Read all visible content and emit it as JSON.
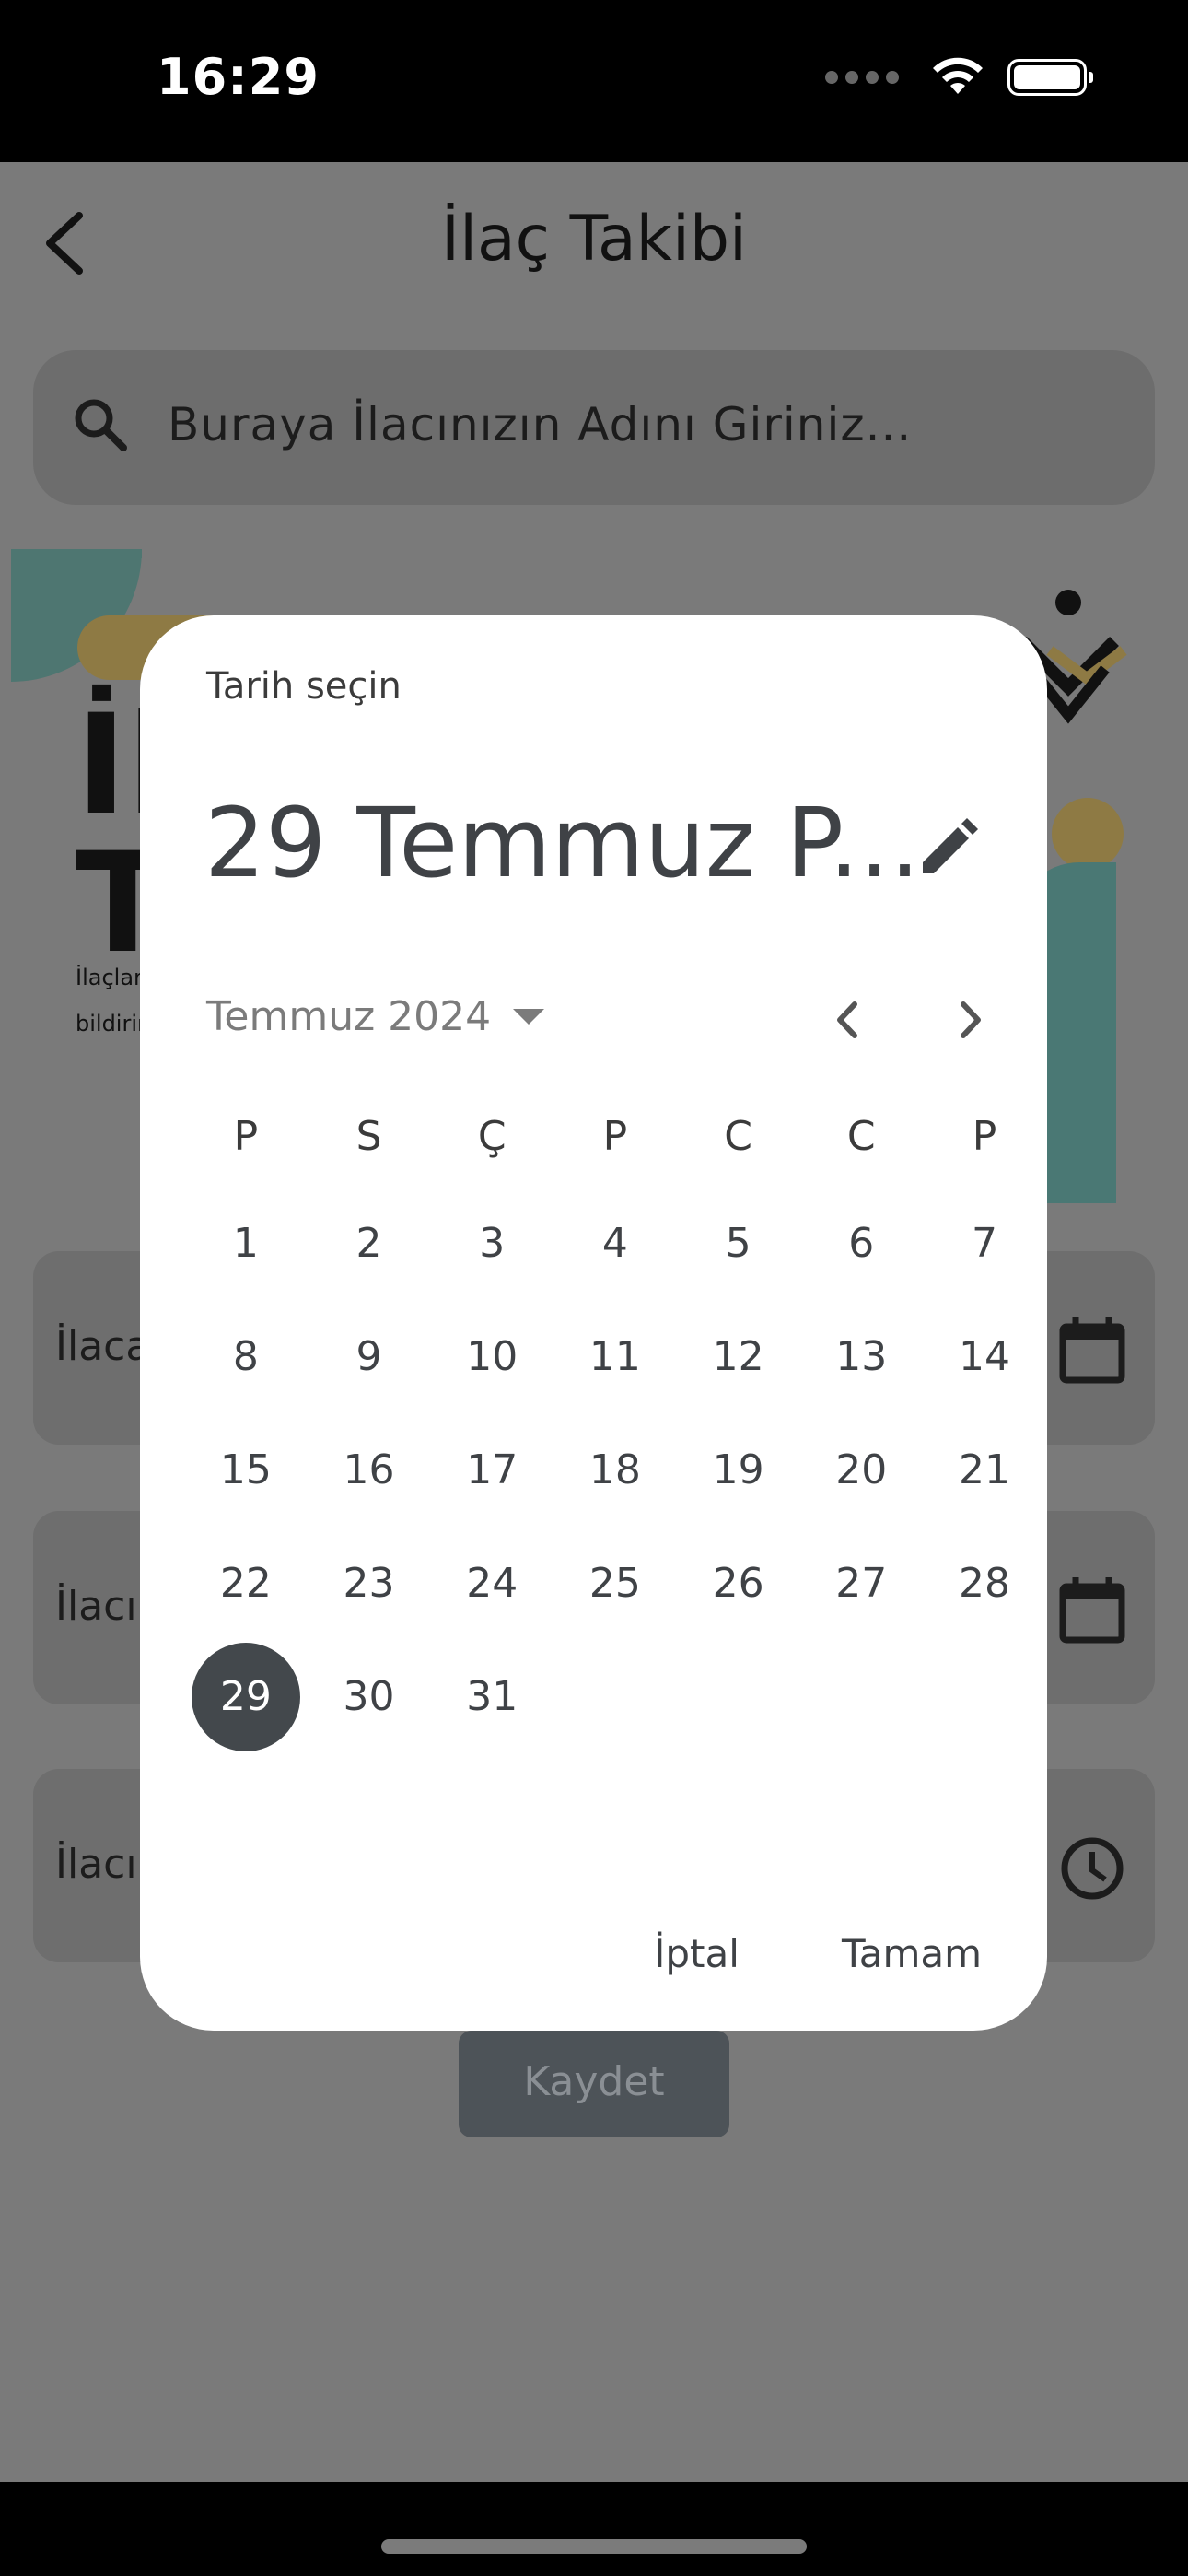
{
  "status_bar": {
    "time": "16:29"
  },
  "header": {
    "title": "İlaç Takibi"
  },
  "search": {
    "placeholder": "Buraya İlacınızın Adını Giriniz..."
  },
  "banner": {
    "big_text_line1": "İl",
    "big_text_line2": "T",
    "small_line1": "İlaçlar",
    "small_line2": "bildirir"
  },
  "fields": [
    {
      "label": "İlaca"
    },
    {
      "label": "İlacı"
    },
    {
      "label": "İlacı"
    }
  ],
  "save_button": {
    "label": "Kaydet"
  },
  "dialog": {
    "headline": "Tarih seçin",
    "selected_date": "29 Temmuz P...",
    "month_year": "Temmuz 2024",
    "weekdays": [
      "P",
      "S",
      "Ç",
      "P",
      "C",
      "C",
      "P"
    ],
    "days": [
      "1",
      "2",
      "3",
      "4",
      "5",
      "6",
      "7",
      "8",
      "9",
      "10",
      "11",
      "12",
      "13",
      "14",
      "15",
      "16",
      "17",
      "18",
      "19",
      "20",
      "21",
      "22",
      "23",
      "24",
      "25",
      "26",
      "27",
      "28",
      "29",
      "30",
      "31"
    ],
    "selected_day": "29",
    "cancel_label": "İptal",
    "ok_label": "Tamam"
  }
}
